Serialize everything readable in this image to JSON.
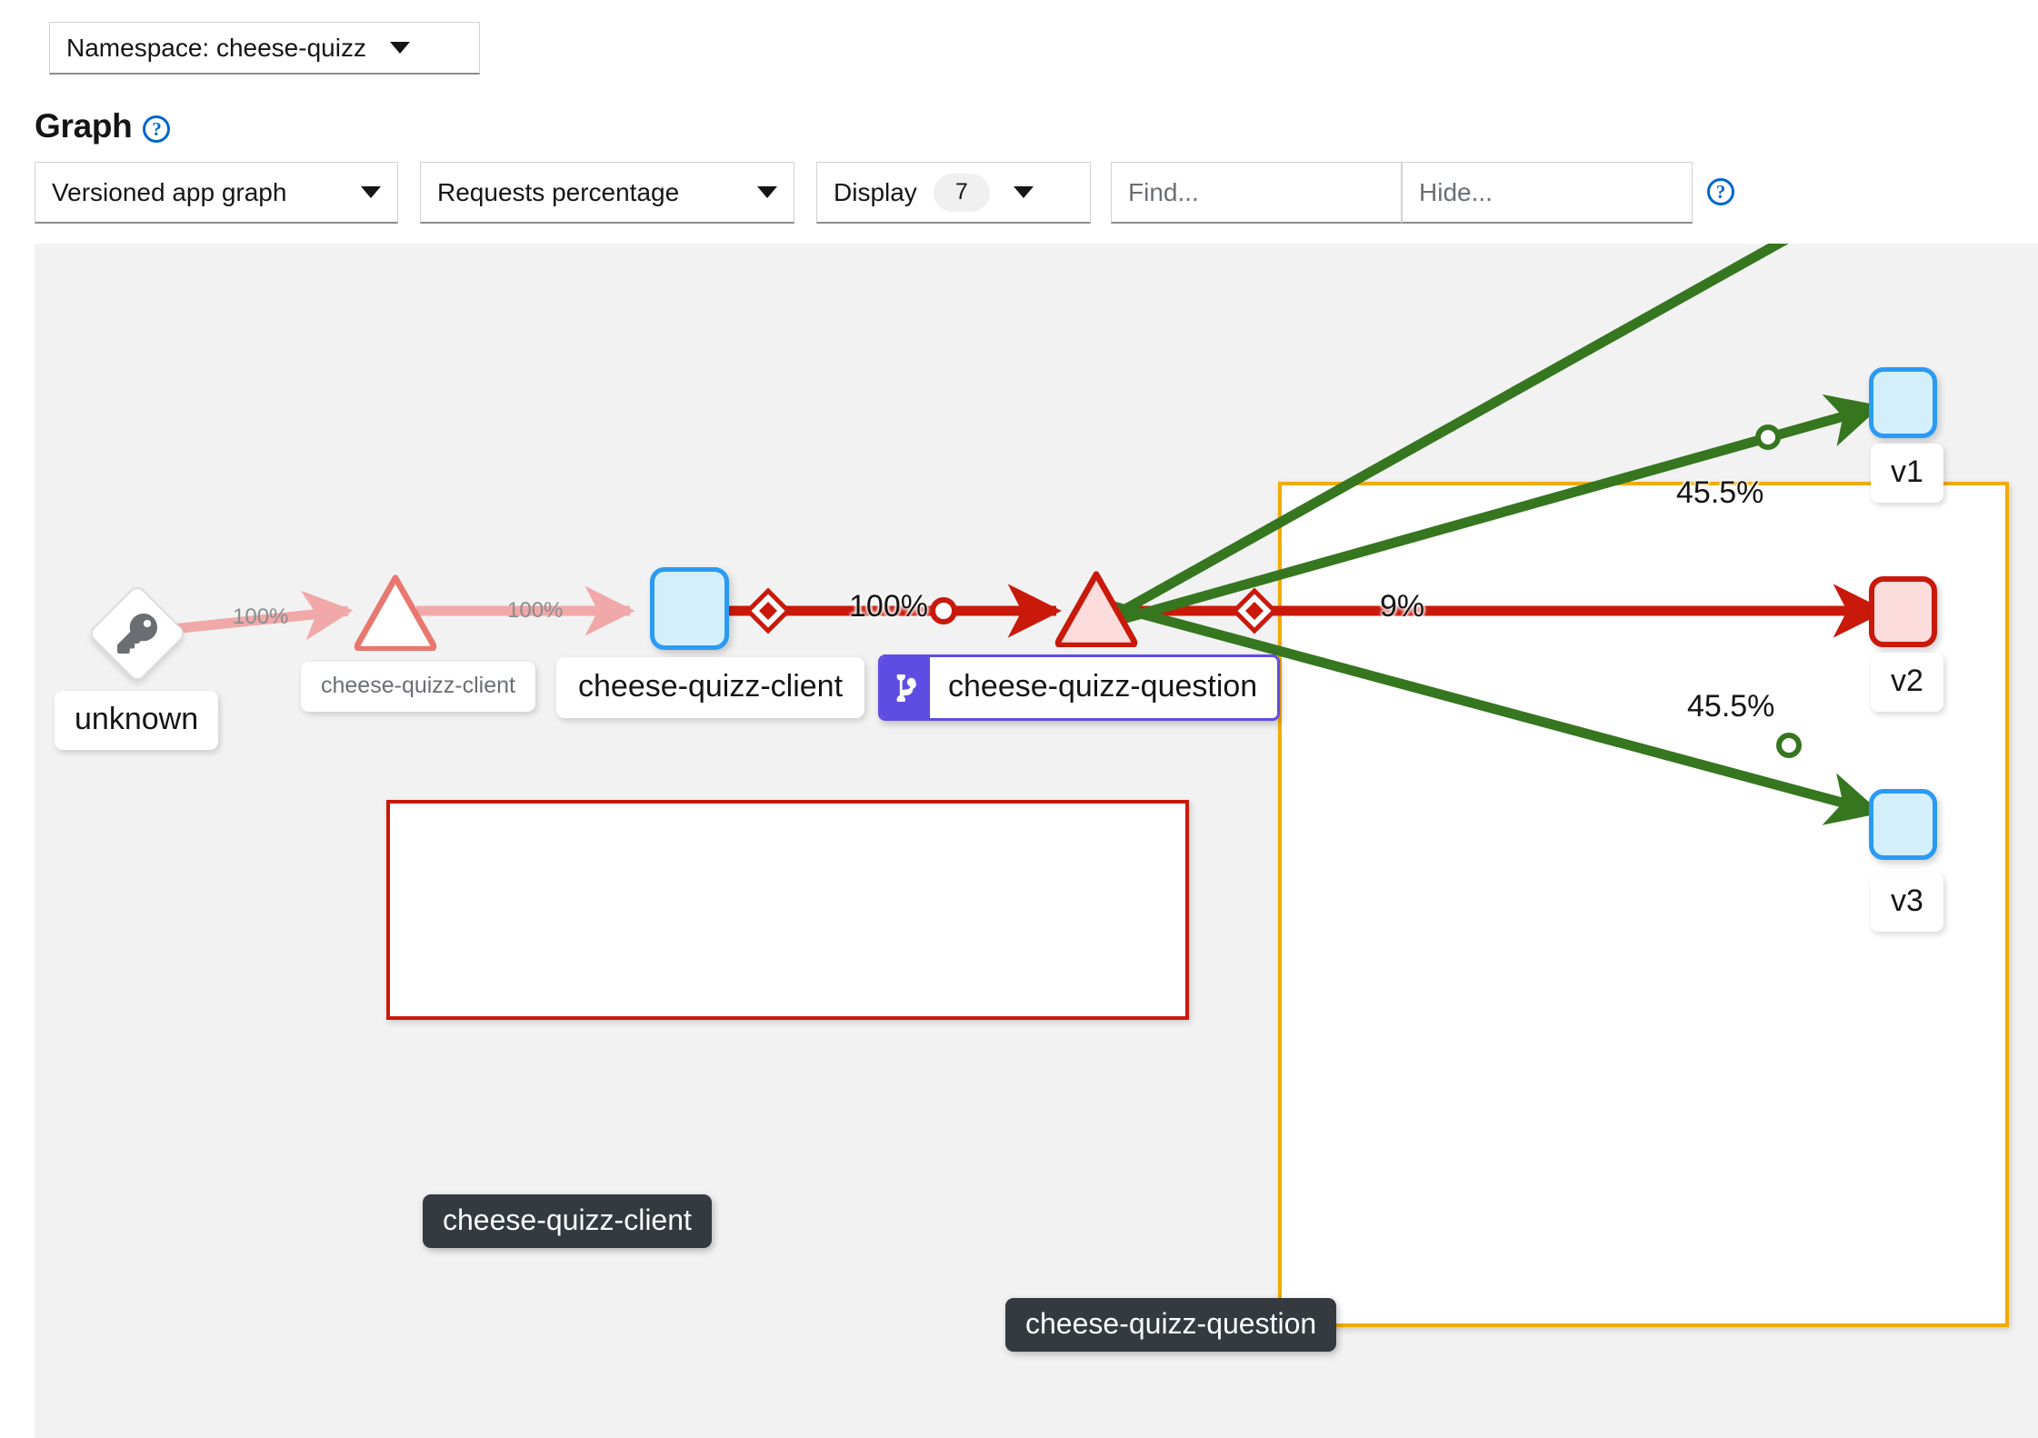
{
  "namespace_selector": {
    "label": "Namespace: cheese-quizz",
    "caret_icon": "caret-down-icon"
  },
  "page": {
    "title": "Graph",
    "help_icon": "question-circle-icon",
    "help_glyph": "?"
  },
  "toolbar": {
    "graph_type": {
      "label": "Versioned app graph",
      "caret_icon": "caret-down-icon"
    },
    "edge_metric": {
      "label": "Requests percentage",
      "caret_icon": "caret-down-icon"
    },
    "display": {
      "label": "Display",
      "count": "7",
      "caret_icon": "caret-down-icon"
    },
    "find": {
      "placeholder": "Find...",
      "value": ""
    },
    "hide": {
      "placeholder": "Hide...",
      "value": ""
    },
    "help_icon": "question-circle-icon",
    "help_glyph": "?"
  },
  "graph": {
    "groups": [
      {
        "name": "cheese-quizz-client",
        "label": "cheese-quizz-client",
        "border_color": "#c9190b"
      },
      {
        "name": "cheese-quizz-question",
        "label": "cheese-quizz-question",
        "border_color": "#f0ab00"
      }
    ],
    "nodes": [
      {
        "id": "unknown",
        "label": "unknown",
        "shape": "diamond",
        "icon": "key-icon",
        "health": "neutral"
      },
      {
        "id": "svc-client",
        "label": "cheese-quizz-client",
        "shape": "triangle",
        "health": "error"
      },
      {
        "id": "app-client",
        "label": "cheese-quizz-client",
        "shape": "round-rect",
        "health": "healthy"
      },
      {
        "id": "svc-question",
        "label": "cheese-quizz-question",
        "shape": "triangle",
        "health": "error",
        "badge_icon": "code-branch-icon"
      },
      {
        "id": "v1",
        "label": "v1",
        "shape": "round-rect",
        "health": "healthy"
      },
      {
        "id": "v2",
        "label": "v2",
        "shape": "round-rect",
        "health": "error"
      },
      {
        "id": "v3",
        "label": "v3",
        "shape": "round-rect",
        "health": "healthy"
      }
    ],
    "edges": [
      {
        "from": "unknown",
        "to": "svc-client",
        "label": "100%",
        "color": "#f0a8a8",
        "style": "faint"
      },
      {
        "from": "svc-client",
        "to": "app-client",
        "label": "100%",
        "color": "#f0a8a8",
        "style": "faint"
      },
      {
        "from": "app-client",
        "to": "svc-question",
        "label": "100%",
        "color": "#c9190b",
        "style": "bold",
        "markers": [
          "diamond",
          "circle"
        ]
      },
      {
        "from": "svc-question",
        "to": "v2",
        "label": "9%",
        "color": "#c9190b",
        "style": "bold",
        "markers": [
          "diamond"
        ]
      },
      {
        "from": "svc-question",
        "to": "v1",
        "label": "45.5%",
        "color": "#35761f",
        "style": "bold",
        "markers": [
          "circle"
        ]
      },
      {
        "from": "svc-question",
        "to": "v3",
        "label": "45.5%",
        "color": "#35761f",
        "style": "bold",
        "markers": [
          "circle"
        ]
      }
    ]
  },
  "colors": {
    "accent_blue": "#0066cc",
    "node_healthy_fill": "#d4effc",
    "node_healthy_border": "#2b9af3",
    "node_error_fill": "#fcdcdc",
    "node_error_border": "#c9190b",
    "edge_error": "#c9190b",
    "edge_ok": "#35761f",
    "edge_faint": "#f0a8a8",
    "group_warn_border": "#f0ab00",
    "group_error_border": "#c9190b",
    "badge_purple": "#5f4de3",
    "canvas_bg": "#f2f2f2",
    "group_label_bg": "#343a40"
  },
  "chart_data": {
    "type": "diagram",
    "title": "Kiali versioned app graph — namespace cheese-quizz",
    "nodes": [
      "unknown",
      "cheese-quizz-client (service)",
      "cheese-quizz-client (app)",
      "cheese-quizz-question (service)",
      "v1",
      "v2",
      "v3"
    ],
    "edge_values": [
      {
        "edge": "unknown -> cheese-quizz-client",
        "value": 100,
        "unit": "%"
      },
      {
        "edge": "cheese-quizz-client svc -> cheese-quizz-client app",
        "value": 100,
        "unit": "%"
      },
      {
        "edge": "cheese-quizz-client app -> cheese-quizz-question svc",
        "value": 100,
        "unit": "%"
      },
      {
        "edge": "cheese-quizz-question -> v1",
        "value": 45.5,
        "unit": "%"
      },
      {
        "edge": "cheese-quizz-question -> v2",
        "value": 9,
        "unit": "%"
      },
      {
        "edge": "cheese-quizz-question -> v3",
        "value": 45.5,
        "unit": "%"
      }
    ]
  }
}
